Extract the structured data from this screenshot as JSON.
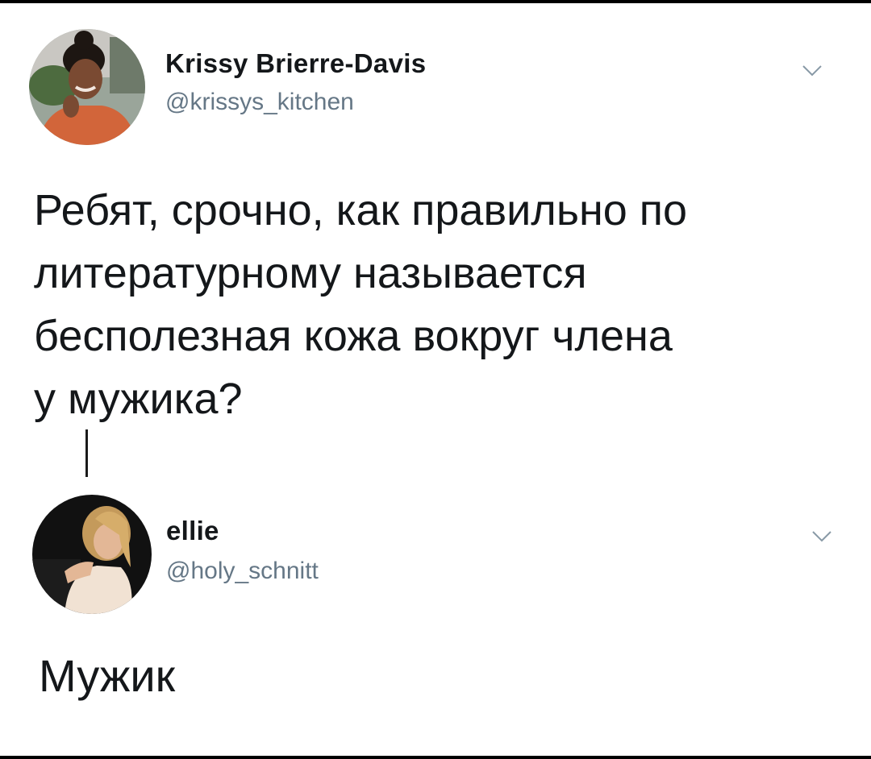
{
  "tweet": {
    "display_name": "Krissy Brierre-Davis",
    "handle": "@krissys_kitchen",
    "text": "Ребят, срочно, как правильно по\nлитературному называется\nбесполезная кожа вокруг члена\nу мужика?"
  },
  "reply": {
    "display_name": "ellie",
    "handle": "@holy_schnitt",
    "text": "Мужик"
  },
  "icons": {
    "menu": "chevron-down-icon"
  },
  "colors": {
    "text": "#14171a",
    "handle": "#657786",
    "chevron": "#8899a6"
  }
}
